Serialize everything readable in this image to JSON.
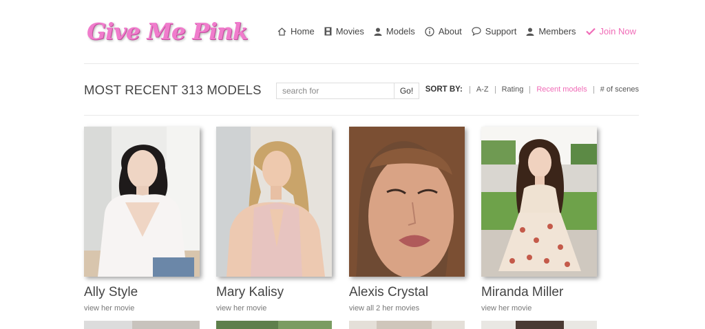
{
  "logo": {
    "text": "Give Me Pink"
  },
  "nav": {
    "home": "Home",
    "movies": "Movies",
    "models": "Models",
    "about": "About",
    "support": "Support",
    "members": "Members",
    "join": "Join Now"
  },
  "colors": {
    "accent": "#f06bb7"
  },
  "toolbar": {
    "title": "MOST RECENT 313 MODELS",
    "search_placeholder": "search for",
    "search_button": "Go!",
    "sort_label": "SORT BY:",
    "sort_options": [
      "A-Z",
      "Rating",
      "Recent models",
      "# of scenes"
    ],
    "active_sort": "Recent models"
  },
  "models": [
    {
      "name": "Ally Style",
      "link": "view her movie"
    },
    {
      "name": "Mary Kalisy",
      "link": "view her movie"
    },
    {
      "name": "Alexis Crystal",
      "link": "view all 2 her movies"
    },
    {
      "name": "Miranda Miller",
      "link": "view her movie"
    }
  ]
}
